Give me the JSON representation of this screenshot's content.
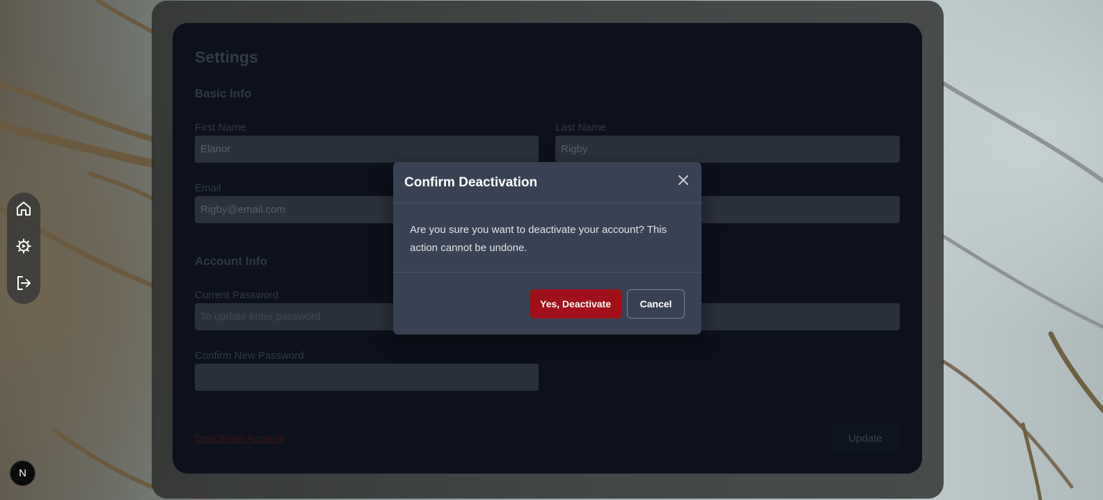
{
  "settings": {
    "title": "Settings",
    "basic_info": {
      "heading": "Basic Info",
      "first_name_label": "First Name",
      "first_name_value": "Elanor",
      "last_name_label": "Last Name",
      "last_name_value": "Rigby",
      "email_label": "Email",
      "email_value": "Rigby@email.com"
    },
    "account_info": {
      "heading": "Account Info",
      "current_password_label": "Current Password",
      "current_password_placeholder": "To update enter password",
      "confirm_new_password_label": "Confirm New Password"
    },
    "deactivate_link": "Deactivate Account",
    "update_button": "Update"
  },
  "dock": {
    "items": [
      {
        "icon": "home-icon"
      },
      {
        "icon": "settings-gear-icon"
      },
      {
        "icon": "logout-icon"
      }
    ]
  },
  "badge": {
    "label": "N"
  },
  "modal": {
    "title": "Confirm Deactivation",
    "body": "Are you sure you want to deactivate your account? This action cannot be undone.",
    "confirm_button": "Yes, Deactivate",
    "cancel_button": "Cancel"
  },
  "colors": {
    "danger": "#a0101a",
    "modal_bg": "#384254",
    "panel_bg": "#0f1524"
  }
}
